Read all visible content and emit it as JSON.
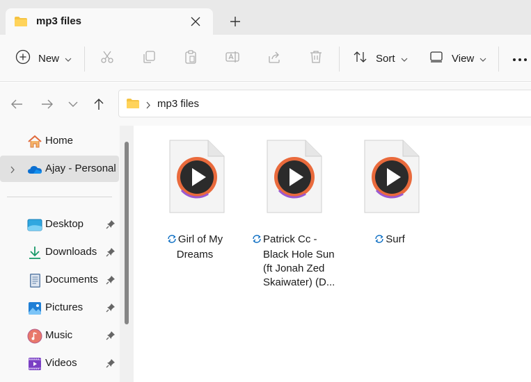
{
  "tab": {
    "title": "mp3 files"
  },
  "toolbar": {
    "new_label": "New",
    "sort_label": "Sort",
    "view_label": "View"
  },
  "address": {
    "path": "mp3 files"
  },
  "sidebar": {
    "items": [
      {
        "label": "Home",
        "icon": "home-icon"
      },
      {
        "label": "Ajay - Personal",
        "icon": "onedrive-icon"
      },
      {
        "label": "Desktop",
        "icon": "desktop-icon",
        "pinned": true
      },
      {
        "label": "Downloads",
        "icon": "download-icon",
        "pinned": true
      },
      {
        "label": "Documents",
        "icon": "documents-icon",
        "pinned": true
      },
      {
        "label": "Pictures",
        "icon": "pictures-icon",
        "pinned": true
      },
      {
        "label": "Music",
        "icon": "music-icon",
        "pinned": true
      },
      {
        "label": "Videos",
        "icon": "videos-icon",
        "pinned": true
      }
    ]
  },
  "files": [
    {
      "line1": "Girl of My",
      "line2": "Dreams",
      "line3": "",
      "line4": ""
    },
    {
      "line1": "Patrick Cc -",
      "line2": "Black Hole Sun",
      "line3": "(ft Jonah Zed",
      "line4": "Skaiwater) (D..."
    },
    {
      "line1": "Surf",
      "line2": "",
      "line3": "",
      "line4": ""
    }
  ],
  "colors": {
    "accent": "#0067c0",
    "folder": "#f5c342",
    "media_ring": "#e96a3c"
  }
}
